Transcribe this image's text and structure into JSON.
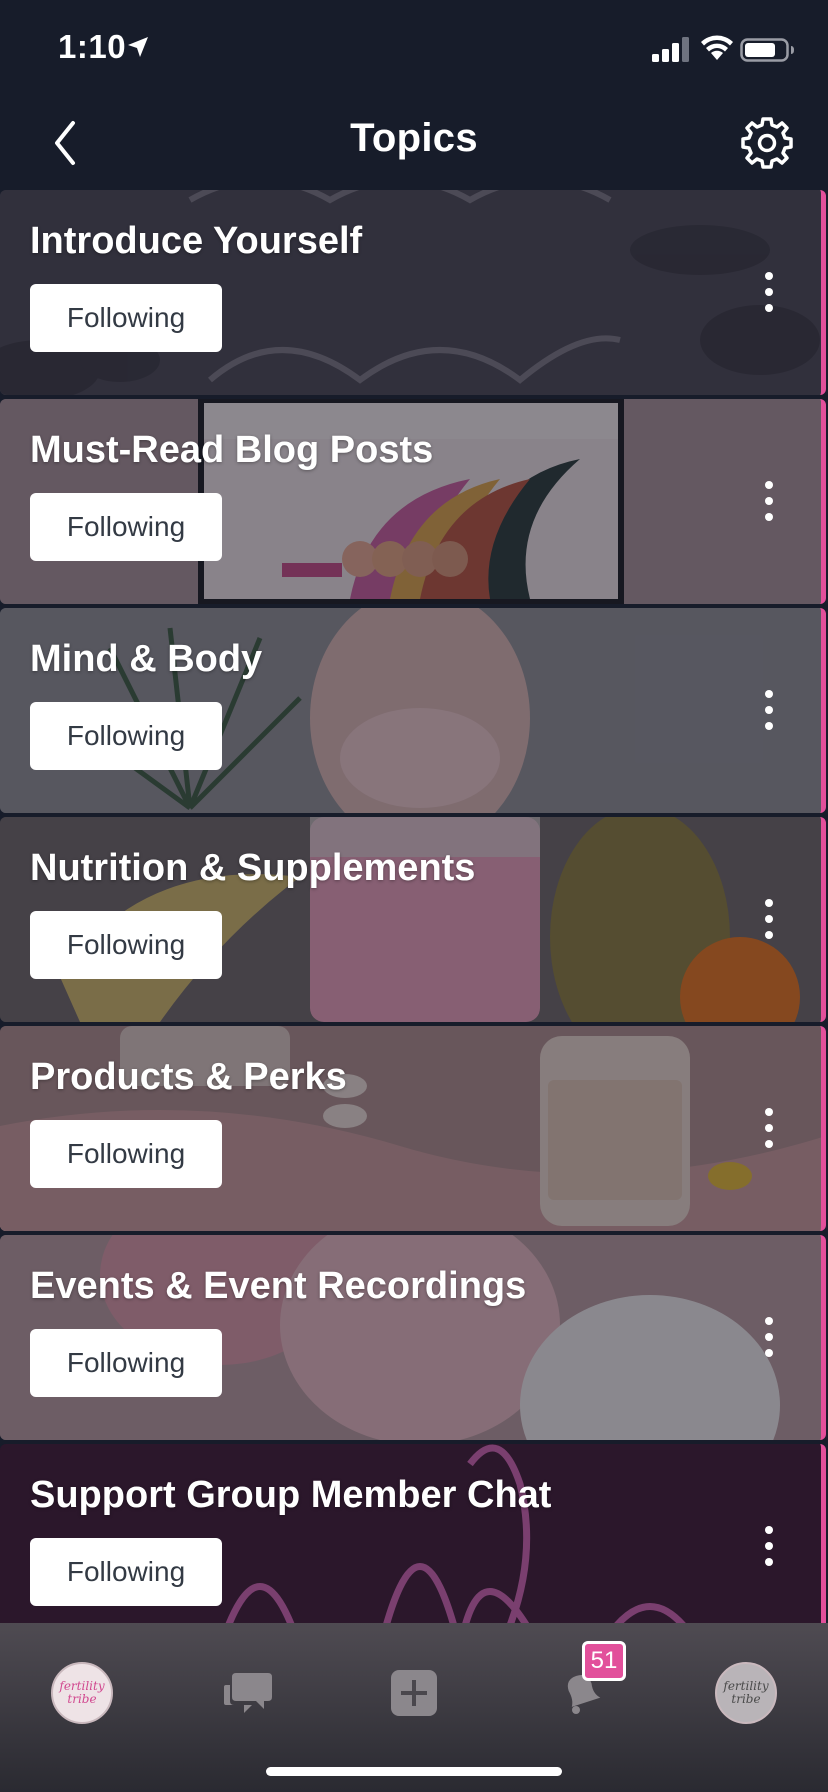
{
  "status_bar": {
    "time": "1:10"
  },
  "header": {
    "title": "Topics"
  },
  "topics": [
    {
      "title": "Introduce Yourself",
      "follow_label": "Following",
      "bg": "#4a4652"
    },
    {
      "title": "Must-Read Blog Posts",
      "follow_label": "Following",
      "bg": "#a78f95"
    },
    {
      "title": "Mind & Body",
      "follow_label": "Following",
      "bg": "#8e8d93"
    },
    {
      "title": "Nutrition & Supplements",
      "follow_label": "Following",
      "bg": "#6d6466"
    },
    {
      "title": "Products & Perks",
      "follow_label": "Following",
      "bg": "#ad8a8a"
    },
    {
      "title": "Events & Event Recordings",
      "follow_label": "Following",
      "bg": "#b6989d"
    },
    {
      "title": "Support Group Member Chat",
      "follow_label": "Following",
      "bg": "#3e1834"
    }
  ],
  "tab_bar": {
    "brand_text": "fertility tribe",
    "notification_count": "51",
    "accent_color": "#e2509b"
  }
}
